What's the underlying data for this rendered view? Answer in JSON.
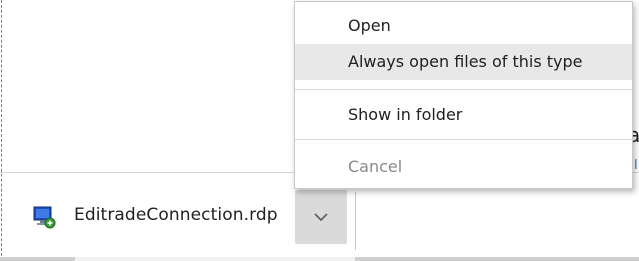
{
  "download": {
    "file_name": "EditradeConnection.rdp",
    "file_icon": "rdp-file-icon",
    "menu_toggle_icon": "chevron-down-icon"
  },
  "context_menu": {
    "items": [
      {
        "label": "Open",
        "enabled": true,
        "highlighted": false
      },
      {
        "label": "Always open files of this type",
        "enabled": true,
        "highlighted": true
      },
      {
        "label": "Show in folder",
        "enabled": true,
        "highlighted": false
      },
      {
        "label": "Cancel",
        "enabled": false,
        "highlighted": false
      }
    ]
  },
  "background": {
    "side_char": "a",
    "side_link": "l"
  },
  "colors": {
    "highlight": "#e8e8e8",
    "disabled_text": "#8a8a8a",
    "toggle_bg": "#dadada",
    "link": "#1a73e8"
  }
}
